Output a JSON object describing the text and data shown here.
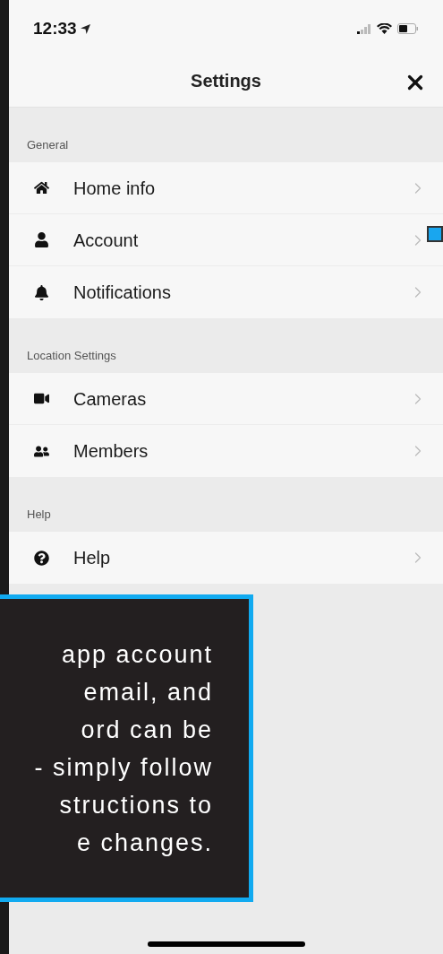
{
  "status_bar": {
    "time": "12:33"
  },
  "nav": {
    "title": "Settings"
  },
  "sections": [
    {
      "title": "General",
      "items": [
        {
          "kind": "home",
          "label": "Home info"
        },
        {
          "kind": "user",
          "label": "Account"
        },
        {
          "kind": "bell",
          "label": "Notifications"
        }
      ]
    },
    {
      "title": "Location Settings",
      "items": [
        {
          "kind": "camera",
          "label": "Cameras"
        },
        {
          "kind": "users",
          "label": "Members"
        }
      ]
    },
    {
      "title": "Help",
      "items": [
        {
          "kind": "help",
          "label": "Help"
        }
      ]
    }
  ],
  "callout": {
    "lines": [
      "app account",
      "email, and",
      "ord can be",
      "- simply follow",
      "structions to",
      "e changes."
    ]
  }
}
